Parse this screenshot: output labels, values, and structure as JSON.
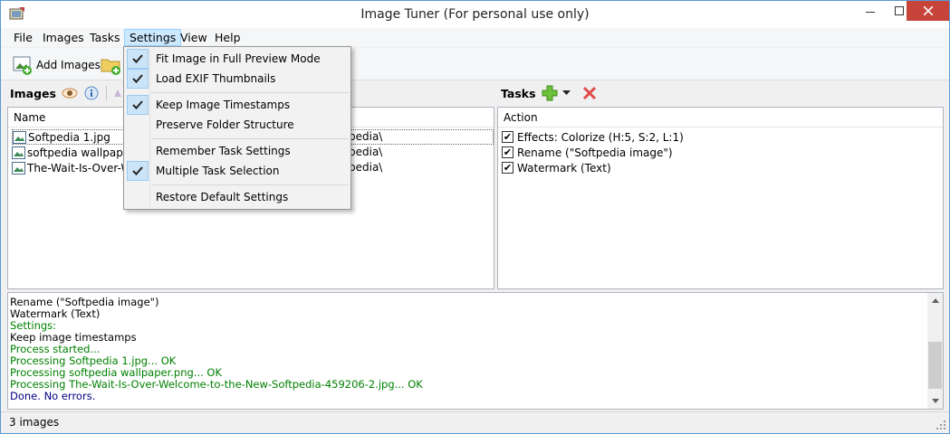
{
  "window": {
    "title": "Image Tuner (For personal use only)"
  },
  "menu": {
    "file": "File",
    "images": "Images",
    "tasks": "Tasks",
    "settings": "Settings",
    "view": "View",
    "help": "Help"
  },
  "toolbar": {
    "add_images": "Add Images"
  },
  "images_panel": {
    "header": "Images",
    "column_name": "Name",
    "rows": [
      {
        "name": "Softpedia 1.jpg",
        "path": "pedia\\"
      },
      {
        "name": "softpedia wallpaper.p",
        "path": "pedia\\"
      },
      {
        "name": "The-Wait-Is-Over-We",
        "path": "pedia\\"
      }
    ]
  },
  "tasks_panel": {
    "header": "Tasks",
    "column_action": "Action",
    "rows": [
      {
        "label": "Effects: Colorize (H:5, S:2, L:1)",
        "checked": true
      },
      {
        "label": "Rename (\"Softpedia image\")",
        "checked": true
      },
      {
        "label": "Watermark (Text)",
        "checked": true
      }
    ]
  },
  "settings_menu": {
    "items": [
      {
        "label": "Fit Image in Full Preview Mode",
        "checked": true
      },
      {
        "label": "Load EXIF Thumbnails",
        "checked": true
      },
      {
        "label": "Keep Image Timestamps",
        "checked": true
      },
      {
        "label": "Preserve Folder Structure",
        "checked": false
      },
      {
        "label": "Remember Task Settings",
        "checked": false
      },
      {
        "label": "Multiple Task Selection",
        "checked": true
      },
      {
        "label": "Restore Default Settings",
        "checked": false
      }
    ]
  },
  "log": {
    "lines": [
      {
        "text": "  Rename (\"Softpedia image\")",
        "color": "#000000"
      },
      {
        "text": "  Watermark (Text)",
        "color": "#000000"
      },
      {
        "text": "Settings:",
        "color": "#008000"
      },
      {
        "text": "  Keep image timestamps",
        "color": "#000000"
      },
      {
        "text": "Process started...",
        "color": "#008000"
      },
      {
        "text": "Processing Softpedia 1.jpg... OK",
        "color": "#008000"
      },
      {
        "text": "Processing softpedia wallpaper.png... OK",
        "color": "#008000"
      },
      {
        "text": "Processing The-Wait-Is-Over-Welcome-to-the-New-Softpedia-459206-2.jpg... OK",
        "color": "#008000"
      },
      {
        "text": "Done. No errors.",
        "color": "#000080"
      }
    ]
  },
  "status": {
    "text": "3 images"
  },
  "colors": {
    "accent": "#5a9ad6",
    "close_button": "#c7443a",
    "menu_highlight": "#cce8ff",
    "log_green": "#008000",
    "log_blue": "#000080"
  }
}
